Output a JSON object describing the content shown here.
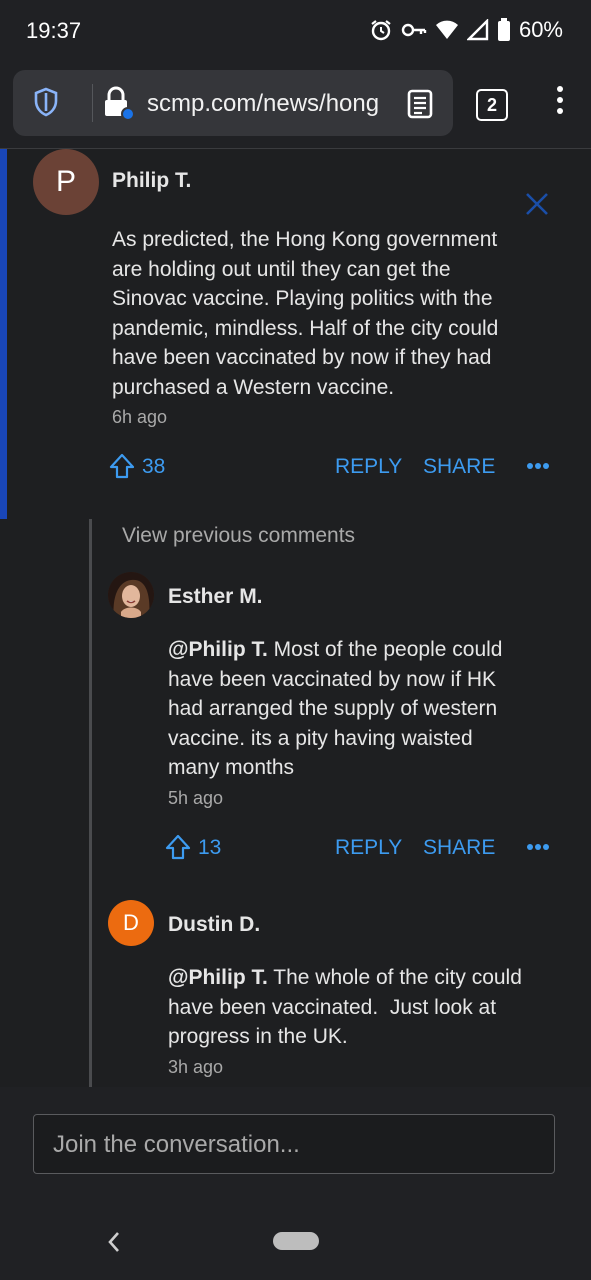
{
  "status_bar": {
    "time": "19:37",
    "battery": "60%"
  },
  "browser": {
    "url": "scmp.com/news/hong",
    "tab_count": "2"
  },
  "comments": [
    {
      "avatar_letter": "P",
      "avatar_color": "#6b4236",
      "author": "Philip T.",
      "lines": [
        "As predicted, the Hong Kong government",
        "are holding out until they can get the",
        "Sinovac vaccine. Playing politics with the",
        "pandemic, mindless. Half of the city could",
        "have been vaccinated by now if they had",
        "purchased a Western vaccine."
      ],
      "time": "6h ago",
      "upvotes": "38",
      "reply": "REPLY",
      "share": "SHARE"
    }
  ],
  "replies": {
    "view_previous": "View previous comments",
    "items": [
      {
        "avatar_type": "photo",
        "author": "Esther M.",
        "mention": "@Philip T.",
        "lines": [
          " Most of the people could",
          "have been vaccinated by now if HK",
          "had arranged the supply of western",
          "vaccine. its a pity having waisted",
          "many months"
        ],
        "time": "5h ago",
        "upvotes": "13",
        "reply": "REPLY",
        "share": "SHARE"
      },
      {
        "avatar_letter": "D",
        "avatar_color": "#ec6b10",
        "author": "Dustin D.",
        "mention": "@Philip T.",
        "lines": [
          " The whole of the city could",
          "have been vaccinated.  Just look at",
          "progress in the UK."
        ],
        "time": "3h ago"
      }
    ]
  },
  "composer": {
    "placeholder": "Join the conversation..."
  },
  "colors": {
    "accent": "#3d9bf0",
    "thread_bar": "#1946b8",
    "background": "#1e1f21"
  }
}
